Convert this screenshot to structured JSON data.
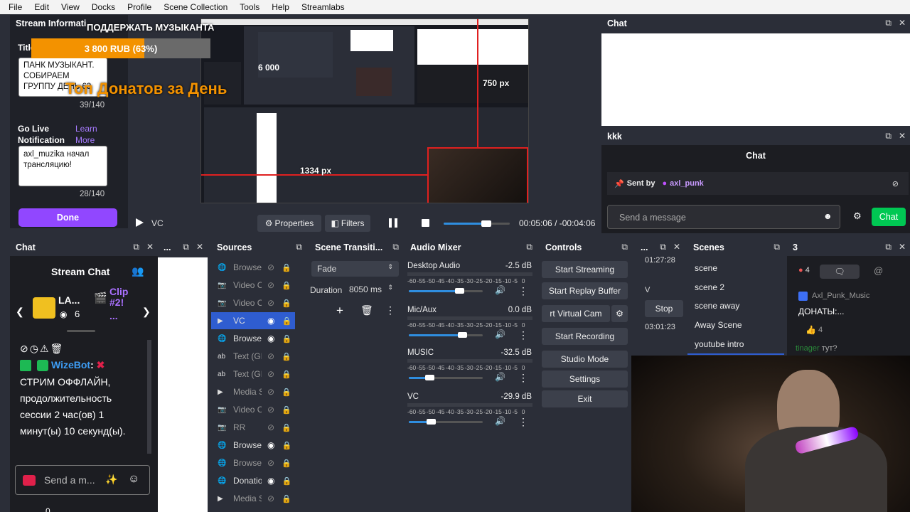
{
  "menu": [
    "File",
    "Edit",
    "View",
    "Docks",
    "Profile",
    "Scene Collection",
    "Tools",
    "Help",
    "Streamlabs"
  ],
  "stream_info": {
    "title_header": "Stream Informati",
    "title_label": "Title",
    "title_value": "ПАНК МУЗЫКАНТ. СОБИРАЕМ ГРУППУ ДЕНЬ 63",
    "title_count": "39/140",
    "golive_label": "Go Live Notification",
    "learn_more": "Learn More",
    "golive_value": "axl_muzika начал трансляцию!",
    "golive_count": "28/140",
    "done": "Done"
  },
  "overlay": {
    "donate_header": "ПОДДЕРЖАТЬ МУЗЫКАНТА",
    "progress_text": "3 800 RUB (63%)",
    "progress_fraction": 0.63,
    "top_donors": "Топ Донатов за День",
    "amount_6000": "6 000",
    "px_750": "750 px",
    "px_1334": "1334 px"
  },
  "player": {
    "source": "VC",
    "properties": "Properties",
    "filters": "Filters",
    "time_current": "00:05:06",
    "time_sep": "/",
    "time_remaining": "-00:04:06",
    "progress": 0.65
  },
  "chat_top": {
    "title": "Chat"
  },
  "kkk": {
    "title": "kkk",
    "subtitle": "Chat",
    "pinned_label": "Sent by",
    "pinned_user": "axl_punk",
    "send_placeholder": "Send a message",
    "chat_button": "Chat"
  },
  "chat_left": {
    "title": "Chat",
    "stream_chat": "Stream Chat",
    "card1": "LA...",
    "card1_count": "6",
    "card2": "Clip #2!",
    "card2_more": "...",
    "bot_name": "WizeBot",
    "bot_message": "СТРИМ ОФФЛАЙН, продолжительность сессии 2 час(ов) 1 минут(ы) 10 секунд(ы).",
    "send_placeholder": "Send a m...",
    "bottom_count": "0"
  },
  "sources": {
    "title": "Sources",
    "items": [
      {
        "type": "globe",
        "name": "Browse",
        "visible": false
      },
      {
        "type": "camera",
        "name": "Video C",
        "visible": false
      },
      {
        "type": "camera",
        "name": "Video C",
        "visible": false
      },
      {
        "type": "play",
        "name": "VC",
        "visible": true,
        "selected": true
      },
      {
        "type": "globe",
        "name": "Browse",
        "visible": true
      },
      {
        "type": "text",
        "name": "Text (GI",
        "visible": false
      },
      {
        "type": "text",
        "name": "Text (GI",
        "visible": false
      },
      {
        "type": "play",
        "name": "Media S",
        "visible": false
      },
      {
        "type": "camera",
        "name": "Video C",
        "visible": false
      },
      {
        "type": "camera",
        "name": "RR",
        "visible": false
      },
      {
        "type": "globe",
        "name": "Browse",
        "visible": true
      },
      {
        "type": "globe",
        "name": "Browse",
        "visible": false
      },
      {
        "type": "globe",
        "name": "Donatio",
        "visible": true
      },
      {
        "type": "play",
        "name": "Media S",
        "visible": false
      }
    ]
  },
  "transitions": {
    "title": "Scene Transiti...",
    "type": "Fade",
    "duration_label": "Duration",
    "duration_value": "8050 ms"
  },
  "mixer": {
    "title": "Audio Mixer",
    "ticks": [
      "-60",
      "-55",
      "-50",
      "-45",
      "-40",
      "-35",
      "-30",
      "-25",
      "-20",
      "-15",
      "-10",
      "-5",
      "0"
    ],
    "channels": [
      {
        "name": "Desktop Audio",
        "db": "-2.5 dB",
        "level": 0.68,
        "muted": false
      },
      {
        "name": "Mic/Aux",
        "db": "0.0 dB",
        "level": 0.72,
        "muted": false
      },
      {
        "name": "MUSIC",
        "db": "-32.5 dB",
        "level": 0.28,
        "muted": true
      },
      {
        "name": "VC",
        "db": "-29.9 dB",
        "level": 0.3,
        "muted": true
      }
    ]
  },
  "controls": {
    "title": "Controls",
    "start_streaming": "Start Streaming",
    "start_replay": "Start Replay Buffer",
    "virtual_cam": "rt Virtual Cam",
    "start_recording": "Start Recording",
    "studio_mode": "Studio Mode",
    "settings": "Settings",
    "exit": "Exit"
  },
  "stats": {
    "title": "...",
    "time1": "01:27:28",
    "v": "V",
    "stop": "Stop",
    "time2": "03:01:23"
  },
  "scenes": {
    "title": "Scenes",
    "items": [
      "scene",
      "scene 2",
      "scene away",
      "Away Scene",
      "youtube intro"
    ]
  },
  "panel3": {
    "title": "3",
    "count": "4",
    "user": "Axl_Punk_Music",
    "message": "ДОНАТЫ:...",
    "likes": "4",
    "next_user": "tinager",
    "next_msg": "тут?"
  },
  "colors": {
    "accent": "#9147ff",
    "twitch_green": "#00c853",
    "bot_blue": "#3d9df5",
    "donate_orange": "#f39200"
  }
}
